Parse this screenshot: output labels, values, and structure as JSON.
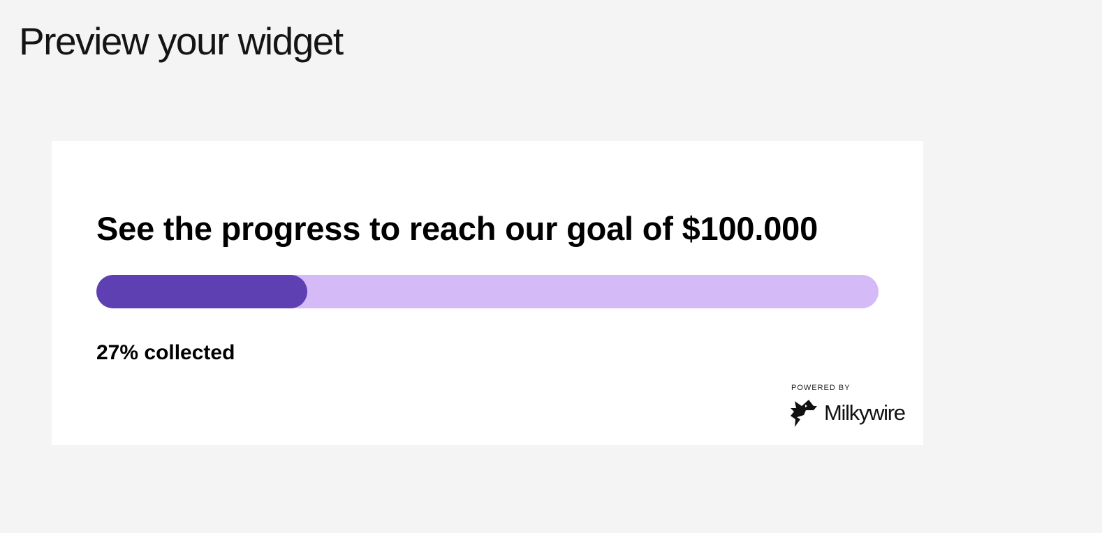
{
  "page": {
    "title": "Preview your widget"
  },
  "widget": {
    "heading": "See the progress to reach our goal of $100.000",
    "progress": {
      "fraction": 0.27,
      "label": "27% collected"
    },
    "footer": {
      "powered_by": "POWERED BY",
      "brand_name": "Milkywire",
      "logo_icon": "milkywire-logo-icon"
    }
  },
  "colors": {
    "background": "#f4f4f4",
    "card": "#ffffff",
    "progress_fill": "#5e40b3",
    "progress_track": "#d5baf8",
    "text": "#000000"
  }
}
